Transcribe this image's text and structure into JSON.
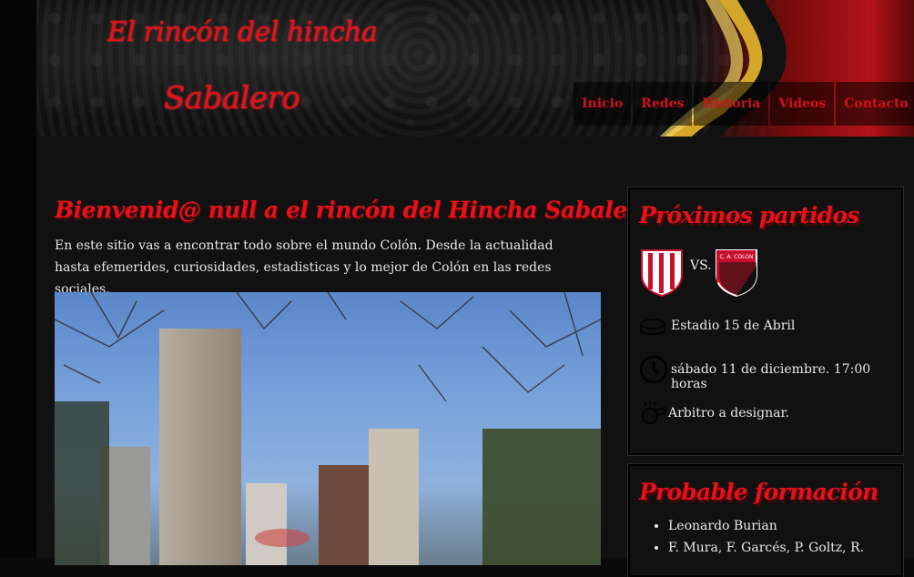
{
  "site": {
    "logo_line1": "El rincón del hincha",
    "logo_line2": "Sabalero"
  },
  "nav": {
    "items": [
      "Inicio",
      "Redes",
      "Historia",
      "Videos",
      "Contacto"
    ]
  },
  "main": {
    "welcome_title": "Bienvenid@ null a el rincón del Hincha Sabalero.",
    "intro_text": "En este sitio vas a encontrar todo sobre el mundo Colón. Desde la actualidad hasta efemerides, curiosidades, estadisticas y lo mejor de Colón en las redes sociales."
  },
  "next_matches": {
    "title": "Próximos partidos",
    "vs_label": "VS.",
    "away_crest_text": "C. A. COLON",
    "stadium": "Estadio 15 de Abril",
    "datetime": "sábado 11 de diciembre. 17:00 horas",
    "referee": "Arbitro a designar."
  },
  "lineup": {
    "title": "Probable formación",
    "players": [
      "Leonardo Burian",
      "F. Mura, F. Garcés, P. Goltz, R."
    ]
  },
  "colors": {
    "accent": "#e8101a",
    "background": "#111111"
  }
}
